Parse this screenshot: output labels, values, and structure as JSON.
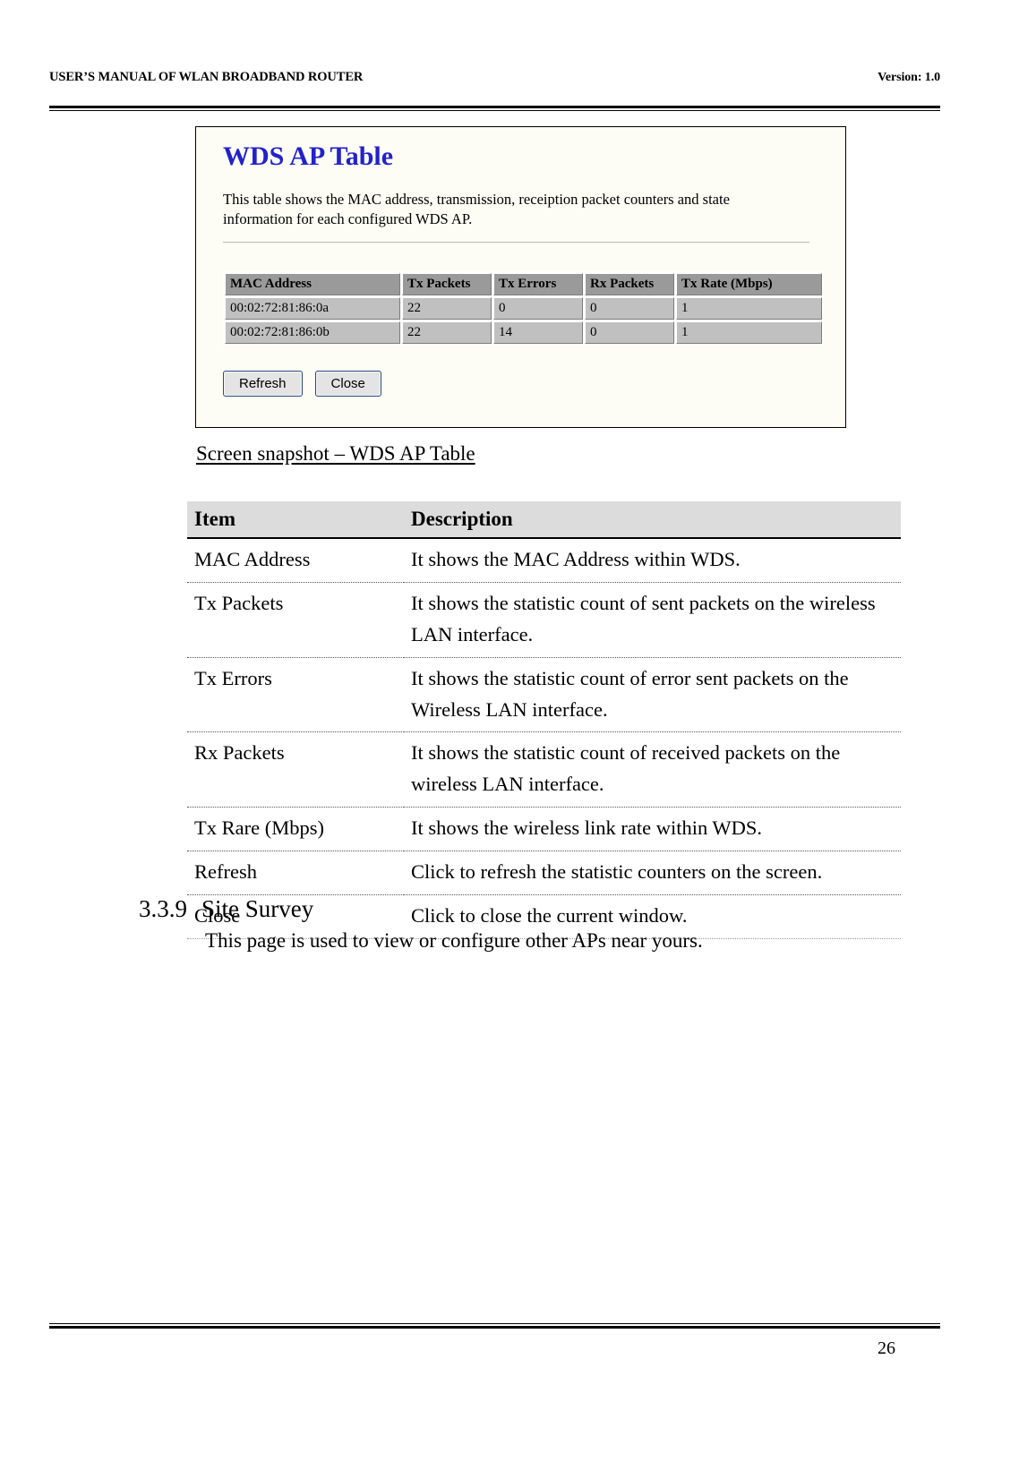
{
  "header": {
    "left": "USER’S MANUAL OF WLAN BROADBAND ROUTER",
    "right": "Version: 1.0"
  },
  "snapshot": {
    "title": "WDS AP Table",
    "description": "This table shows the MAC address, transmission, receiption packet counters and state information for each configured WDS AP.",
    "table": {
      "columns": [
        "MAC Address",
        "Tx Packets",
        "Tx Errors",
        "Rx Packets",
        "Tx Rate (Mbps)"
      ],
      "rows": [
        [
          "00:02:72:81:86:0a",
          "22",
          "0",
          "0",
          "1"
        ],
        [
          "00:02:72:81:86:0b",
          "22",
          "14",
          "0",
          "1"
        ]
      ]
    },
    "buttons": {
      "refresh": "Refresh",
      "close": "Close"
    }
  },
  "figure_caption": "Screen snapshot – WDS AP Table",
  "description_table": {
    "columns": [
      "Item",
      "Description"
    ],
    "rows": [
      {
        "item": "MAC Address",
        "description": "It shows the MAC Address within WDS."
      },
      {
        "item": "Tx Packets",
        "description": "It shows the statistic count of sent packets on the wireless LAN interface."
      },
      {
        "item": "Tx Errors",
        "description": "It shows the statistic count of error sent packets on the Wireless LAN interface."
      },
      {
        "item": "Rx Packets",
        "description": "It shows the statistic count of received packets on the wireless LAN interface."
      },
      {
        "item": "Tx Rare (Mbps)",
        "description": "It shows the wireless link rate within WDS."
      },
      {
        "item": "Refresh",
        "description": "Click to refresh the statistic counters on the screen."
      },
      {
        "item": "Close",
        "description": "Click to close the current window."
      }
    ]
  },
  "section": {
    "number": "3.3.9",
    "title": "Site Survey",
    "body": "This page is used to view or configure other APs near yours."
  },
  "footer": {
    "page_number": "26"
  },
  "colors": {
    "snapshot_title": "#2222cc",
    "table_header_bg": "#9a9a9a",
    "table_cell_bg": "#c0c0c0",
    "desc_header_bg": "#dcdcdc"
  }
}
